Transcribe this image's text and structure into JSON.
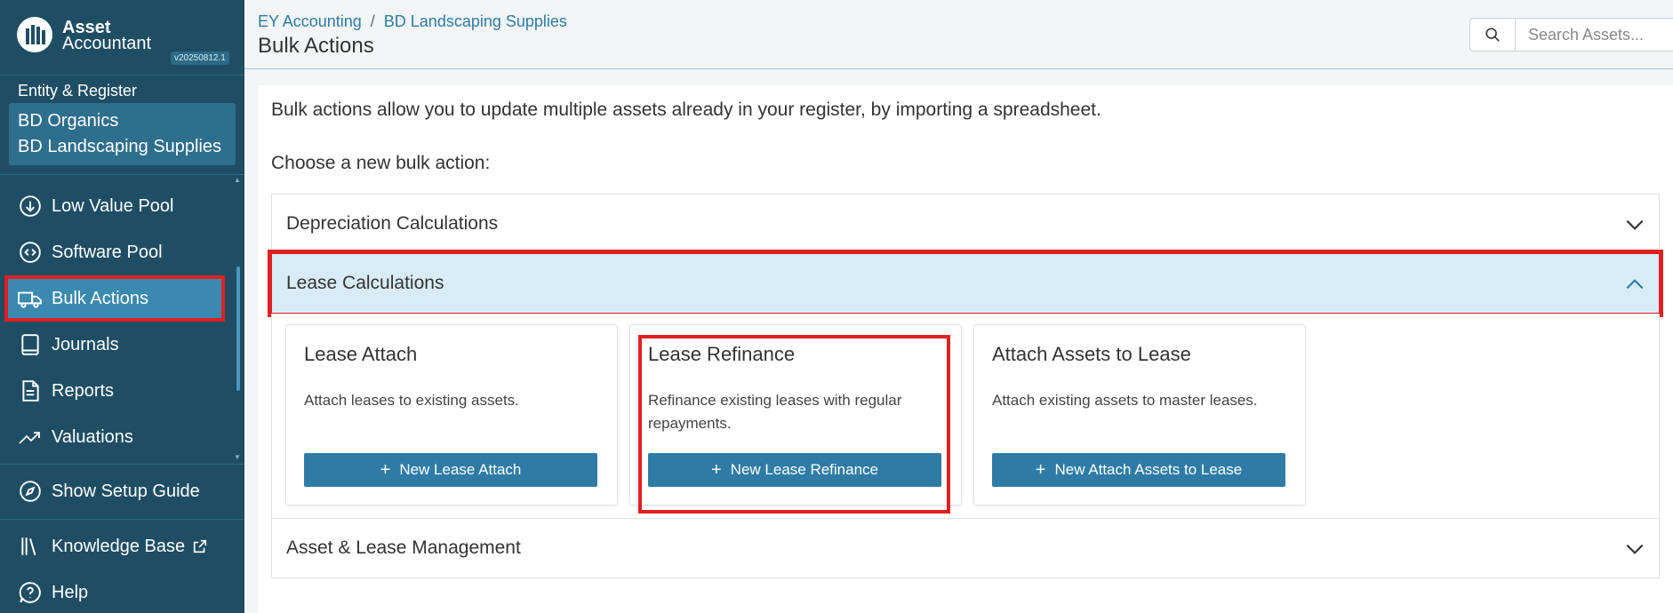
{
  "brand": {
    "name_line1": "Asset",
    "name_line2": "Accountant",
    "version": "v20250812.1"
  },
  "entity": {
    "label": "Entity & Register",
    "line1": "BD Organics",
    "line2": "BD Landscaping Supplies"
  },
  "nav": {
    "items": [
      {
        "label": "Low Value Pool",
        "icon": "download-circle-icon"
      },
      {
        "label": "Software Pool",
        "icon": "code-circle-icon"
      },
      {
        "label": "Bulk Actions",
        "icon": "truck-icon",
        "active": true
      },
      {
        "label": "Journals",
        "icon": "book-icon"
      },
      {
        "label": "Reports",
        "icon": "document-icon"
      },
      {
        "label": "Valuations",
        "icon": "trending-up-icon"
      }
    ],
    "setup_guide": "Show Setup Guide",
    "knowledge_base": "Knowledge Base",
    "help": "Help"
  },
  "header": {
    "breadcrumb": [
      "EY Accounting",
      "BD Landscaping Supplies"
    ],
    "separator": "/",
    "title": "Bulk Actions",
    "search_placeholder": "Search Assets..."
  },
  "main": {
    "intro": "Bulk actions allow you to update multiple assets already in your register, by importing a spreadsheet.",
    "choose": "Choose a new bulk action:",
    "sections": [
      {
        "title": "Depreciation Calculations",
        "expanded": false
      },
      {
        "title": "Lease Calculations",
        "expanded": true
      },
      {
        "title": "Asset & Lease Management",
        "expanded": false
      }
    ],
    "cards": [
      {
        "title": "Lease Attach",
        "desc": "Attach leases to existing assets.",
        "button": "New Lease Attach"
      },
      {
        "title": "Lease Refinance",
        "desc": "Refinance existing leases with regular repayments.",
        "button": "New Lease Refinance"
      },
      {
        "title": "Attach Assets to Lease",
        "desc": "Attach existing assets to master leases.",
        "button": "New Attach Assets to Lease"
      }
    ]
  },
  "colors": {
    "sidebar_bg": "#1f4e64",
    "active_item": "#3a8ab0",
    "accent": "#2e7ca6",
    "expanded_bg": "#d7ecf7",
    "highlight": "#e02020"
  }
}
